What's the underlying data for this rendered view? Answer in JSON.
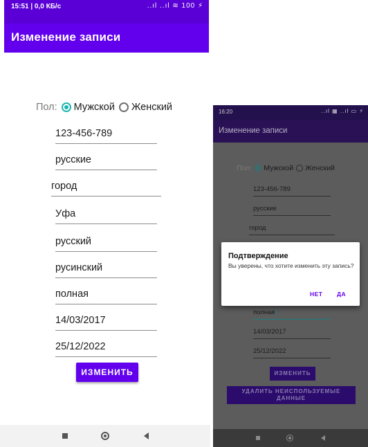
{
  "colors": {
    "primary": "#6200ee",
    "status_bar": "#5a00d6",
    "radio_accent": "#1ab5b0",
    "dialog_button": "#6200ee"
  },
  "left_screen": {
    "status": {
      "time": "15:51 | 0,0 КБ/с",
      "icons": "..ıl ..ıl ≋ 100 ⚡"
    },
    "app_bar": {
      "title": "Изменение записи"
    },
    "gender": {
      "label": "Пол:",
      "option_male": "Мужской",
      "option_female": "Женский",
      "selected": "Мужской"
    },
    "fields": [
      "123-456-789",
      "русские",
      "город",
      "Уфа",
      "русский",
      "русинский",
      "полная",
      "14/03/2017",
      "25/12/2022"
    ],
    "button_change": "ИЗМЕНИТЬ",
    "nav_icons": [
      "square-icon",
      "circle-icon",
      "triangle-icon"
    ]
  },
  "right_screen": {
    "status": {
      "time": "16:20",
      "icons": "..ıl ▦ ..ıl ▭ ⚡"
    },
    "app_bar": {
      "title": "Изменение записи"
    },
    "gender": {
      "label": "Пол:",
      "option_male": "Мужской",
      "option_female": "Женский",
      "selected": "Мужской"
    },
    "fields_visible_top": [
      "123-456-789",
      "русские",
      "город"
    ],
    "fields_visible_bottom": [
      "полная",
      "14/03/2017",
      "25/12/2022"
    ],
    "button_change": "ИЗМЕНИТЬ",
    "button_delete": "УДАЛИТЬ НЕИСПОЛЬЗУЕМЫЕ ДАННЫЕ",
    "dialog": {
      "title": "Подтверждение",
      "message": "Вы уверены, что хотите изменить эту запись?",
      "button_no": "НЕТ",
      "button_yes": "ДА"
    }
  }
}
